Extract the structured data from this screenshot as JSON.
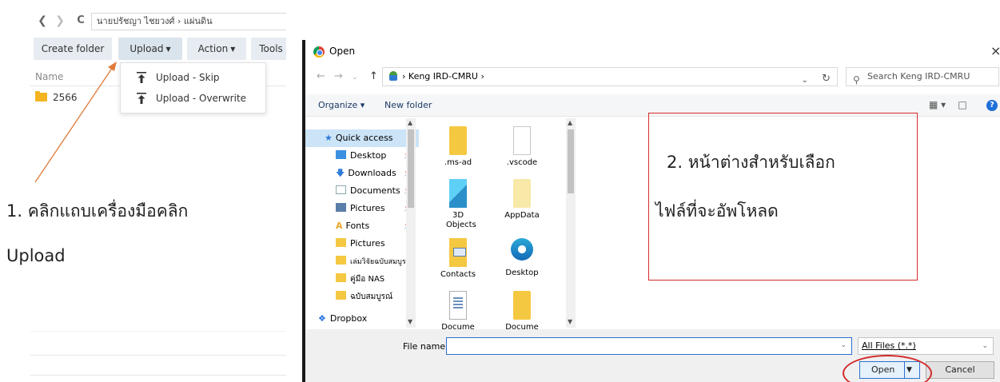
{
  "file_manager": {
    "breadcrumb": "นายปรัชญา ไชยวงศ์ › แผ่นดิน",
    "toolbar": {
      "create_folder": "Create folder",
      "upload": "Upload",
      "action": "Action",
      "tools": "Tools"
    },
    "column_name": "Name",
    "rows": [
      {
        "name": "2566"
      }
    ],
    "upload_menu": {
      "skip": "Upload - Skip",
      "overwrite": "Upload - Overwrite"
    }
  },
  "annotations": {
    "step1_line1": "1. คลิกแถบเครื่องมือคลิก",
    "step1_line2": "Upload",
    "step2_line1": "2. หน้าต่างสำหรับเลือก",
    "step2_line2": "ไฟล์ที่จะอัพโหลด"
  },
  "open_dialog": {
    "title": "Open",
    "close": "×",
    "address": "Keng IRD-CMRU",
    "search_placeholder": "Search Keng IRD-CMRU",
    "organize": "Organize",
    "new_folder": "New folder",
    "help": "?",
    "nav_pane": [
      {
        "label": "Quick access",
        "icon": "star-icon"
      },
      {
        "label": "Desktop",
        "icon": "desktop-icon",
        "pinned": true
      },
      {
        "label": "Downloads",
        "icon": "download-icon",
        "pinned": true
      },
      {
        "label": "Documents",
        "icon": "documents-icon",
        "pinned": true
      },
      {
        "label": "Pictures",
        "icon": "pictures-icon",
        "pinned": true
      },
      {
        "label": "Fonts",
        "icon": "fonts-icon",
        "pinned": true
      },
      {
        "label": "Pictures",
        "icon": "folder-icon"
      },
      {
        "label": "เล่มวิจัยฉบับสมบูรณ์",
        "icon": "folder-icon"
      },
      {
        "label": "คู่มือ NAS",
        "icon": "folder-icon"
      },
      {
        "label": "ฉบับสมบูรณ์",
        "icon": "folder-icon"
      },
      {
        "label": "Dropbox",
        "icon": "dropbox-icon"
      }
    ],
    "files": [
      {
        "name": ".ms-ad",
        "icon": "folder-icon"
      },
      {
        "name": ".vscode",
        "icon": "file-icon"
      },
      {
        "name": "3D Objects",
        "icon": "3d-objects-icon"
      },
      {
        "name": "AppData",
        "icon": "folder-faded-icon"
      },
      {
        "name": "Contacts",
        "icon": "contacts-icon"
      },
      {
        "name": "Desktop",
        "icon": "edge-icon"
      },
      {
        "name": "Docume",
        "icon": "document-icon"
      },
      {
        "name": "Docume",
        "icon": "folder-icon"
      }
    ],
    "file_name_label": "File name:",
    "file_name_value": "",
    "file_type": "All Files (*.*)",
    "open_button": "Open",
    "cancel_button": "Cancel"
  },
  "colors": {
    "annotation_red": "#d42a2a",
    "arrow_orange": "#e07a3a",
    "folder_yellow": "#f4b422",
    "dialog_accent": "#2c6fd2"
  }
}
